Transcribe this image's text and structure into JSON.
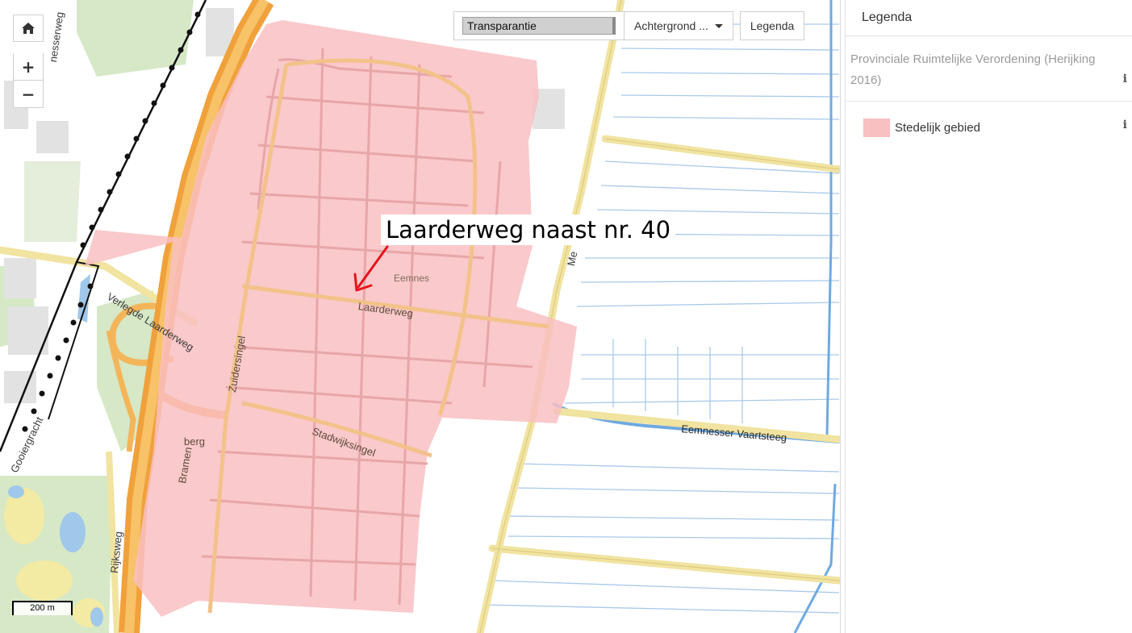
{
  "map": {
    "toolbar": {
      "transparency_label": "Transparantie",
      "background_label": "Achtergrond ...",
      "legend_label": "Legenda"
    },
    "zoom": {
      "home_icon": "home-icon",
      "zoom_in": "+",
      "zoom_out": "−"
    },
    "annotation": "Laarderweg naast nr. 40",
    "annotation_color": "#e8131b",
    "scale_label": "200 m",
    "overlay_color": "#f9c0c2",
    "street_labels": {
      "eemnes": "Eemnes",
      "laarderweg": "Laarderweg",
      "verlegde": "Verlegde Laarderweg",
      "zuidersingel": "Zuidersingel",
      "stadwijksingel": "Stadwijksingel",
      "bramenberg_1": "Bramen",
      "bramenberg_2": "berg",
      "rijksweg": "Rijksweg",
      "vaartsteeg": "Eemnesser Vaartsteeg",
      "meent": "Me",
      "nesserweg": "nesserweg",
      "gooiergracht": "Gooiergracht"
    }
  },
  "legend": {
    "title": "Legenda",
    "layer_title": "Provinciale Ruimtelijke Verordening (Herijking 2016)",
    "items": [
      {
        "label": "Stedelijk gebied",
        "color": "#f9c0c2"
      }
    ],
    "info_glyph": "i"
  }
}
